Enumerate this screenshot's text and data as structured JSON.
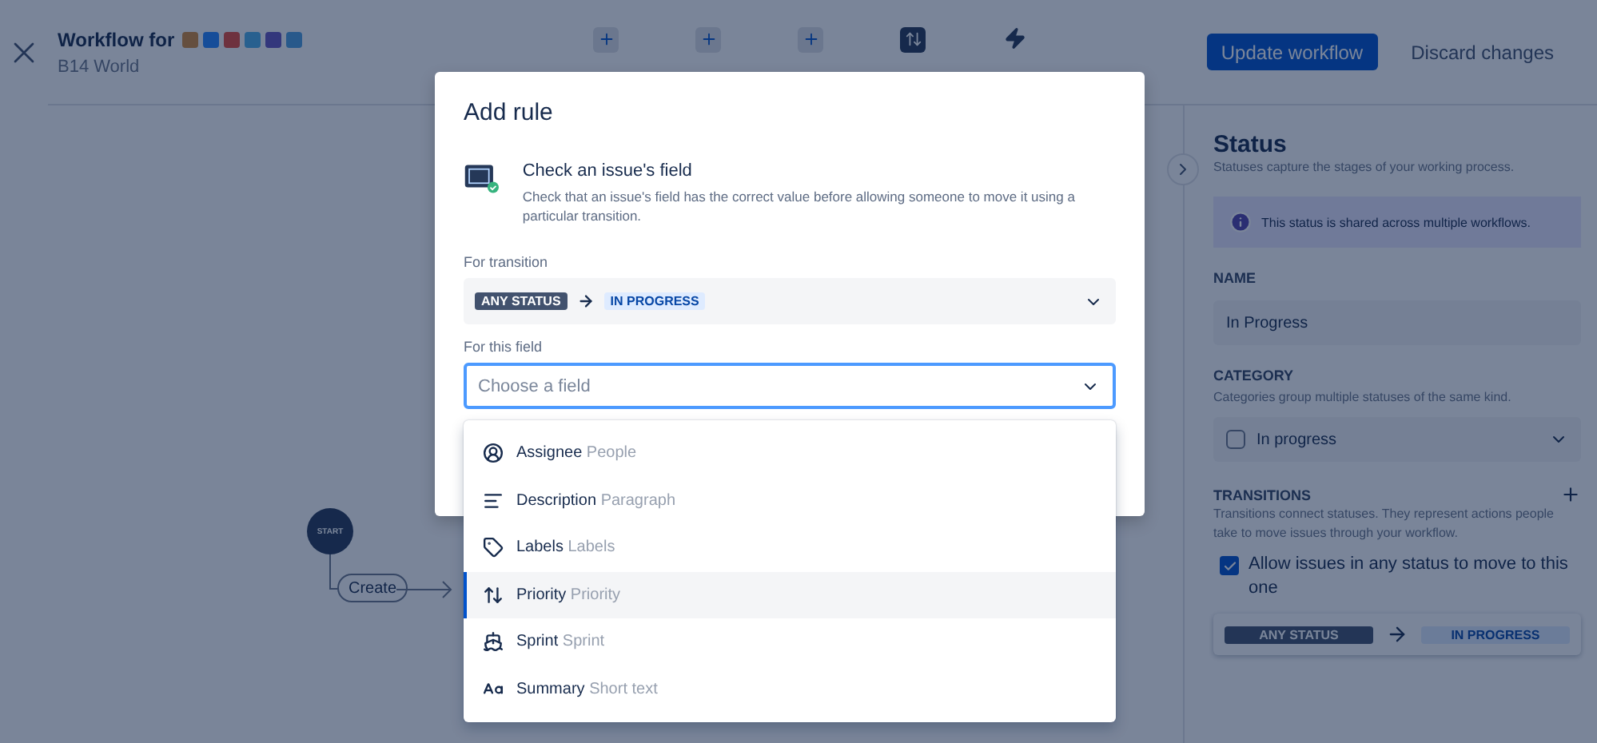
{
  "header": {
    "title": "Workflow for",
    "subtitle": "B14 World",
    "issue_types": [
      {
        "color": "#654f3f"
      },
      {
        "color": "#164d99"
      },
      {
        "color": "#6e323f"
      },
      {
        "color": "#28608f"
      },
      {
        "color": "#33377c"
      },
      {
        "color": "#28598b"
      }
    ],
    "buttons": [
      {
        "label": "Update workflow",
        "kind": "primary"
      },
      {
        "label": "Discard changes",
        "kind": "subtle"
      }
    ]
  },
  "canvas": {
    "start": "START",
    "transition": "Create"
  },
  "panel": {
    "title": "Status",
    "subtitle": "Statuses capture the stages of your working process.",
    "notice": "This status is shared across multiple workflows.",
    "name_label": "NAME",
    "name_value": "In Progress",
    "category_label": "CATEGORY",
    "category_hint": "Categories group multiple statuses of the same kind.",
    "category_value": "In progress",
    "transitions_label": "TRANSITIONS",
    "transitions_hint": "Transitions connect statuses. They represent actions people take to move issues through your workflow.",
    "allow_any": {
      "label": "Allow issues in any status to move to this one",
      "checked": true
    },
    "from": "ANY STATUS",
    "to": "IN PROGRESS"
  },
  "modal": {
    "title": "Add rule",
    "rule_title": "Check an issue's field",
    "rule_description": "Check that an issue's field has the correct value before allowing someone to move it using a particular transition.",
    "transition_label": "For transition",
    "from": "ANY STATUS",
    "to": "IN PROGRESS",
    "field_label": "For this field",
    "field_placeholder": "Choose a field",
    "options": [
      {
        "name": "Assignee",
        "type": "People",
        "selected": false
      },
      {
        "name": "Description",
        "type": "Paragraph",
        "selected": false
      },
      {
        "name": "Labels",
        "type": "Labels",
        "selected": false
      },
      {
        "name": "Priority",
        "type": "Priority",
        "selected": true
      },
      {
        "name": "Sprint",
        "type": "Sprint",
        "selected": false
      },
      {
        "name": "Summary",
        "type": "Short text",
        "selected": false
      }
    ]
  }
}
